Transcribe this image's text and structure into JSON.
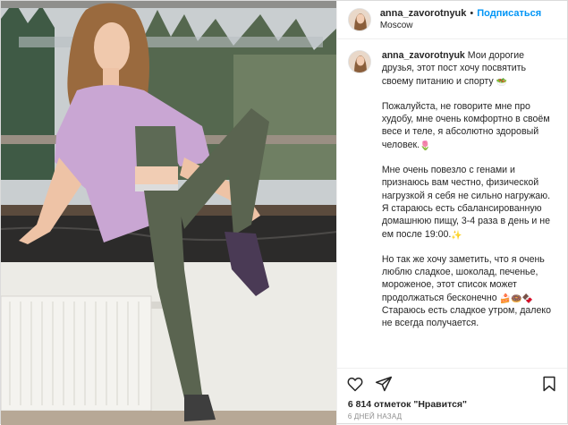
{
  "header": {
    "username": "anna_zavorotnyuk",
    "separator": "•",
    "follow_label": "Подписаться",
    "location": "Moscow"
  },
  "caption": {
    "username": "anna_zavorotnyuk",
    "paragraphs": [
      "Мои дорогие друзья, этот пост хочу посвятить своему питанию и спорту",
      "Пожалуйста, не говорите мне про худобу, мне очень комфортно в своём весе и теле, я абсолютно здоровый человек.",
      "Мне очень повезло с генами и признаюсь вам честно, физической нагрузкой я себя не сильно нагружаю. Я стараюсь есть сбалансированную домашнюю пищу, 3-4 раза в день и не ем после 19:00.",
      "Но так же хочу заметить, что я очень люблю сладкое, шоколад, печенье, мороженое, этот список может продолжаться бесконечно",
      "Стараюсь есть сладкое утром, далеко не всегда получается."
    ],
    "emojis": {
      "p1": "🥗",
      "p2": "🌷",
      "p3": "✨",
      "p4": "🍰🍩🍫"
    }
  },
  "actions": {
    "like_icon": "heart-icon",
    "share_icon": "paper-plane-icon",
    "save_icon": "bookmark-icon"
  },
  "likes_text": "6 814 отметок \"Нравится\"",
  "timestamp": "6 ДНЕЙ НАЗАД",
  "colors": {
    "follow_blue": "#0095f6",
    "text": "#262626",
    "muted": "#8e8e8e"
  }
}
